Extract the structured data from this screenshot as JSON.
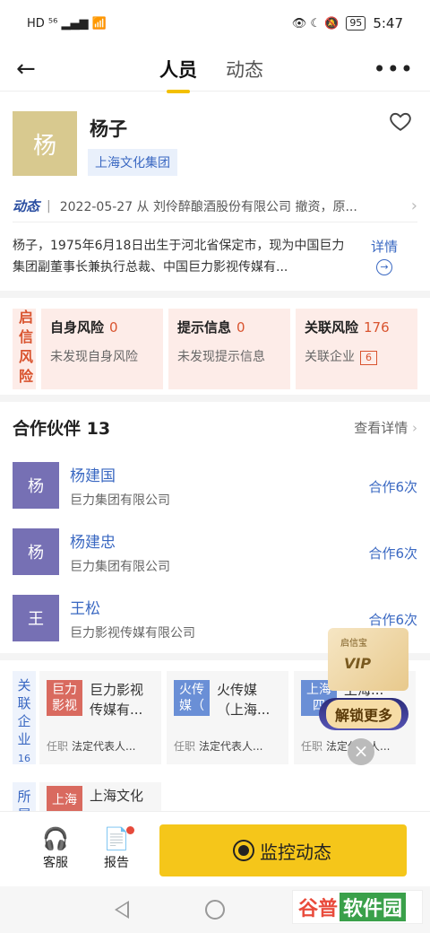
{
  "status_bar": {
    "left_icons": "HD ⁵⁶ ▂▄▆ 📶",
    "right_icons": "👁 ☾ 🔕",
    "battery": "95",
    "time": "5:47"
  },
  "header": {
    "tabs": [
      {
        "label": "人员",
        "active": true
      },
      {
        "label": "动态",
        "active": false
      }
    ],
    "more": "•••"
  },
  "profile": {
    "avatar_char": "杨",
    "name": "杨子",
    "company_tag": "上海文化集团",
    "dynamic_label": "动态",
    "dynamic_text": "2022-05-27 从 刘伶醉酿酒股份有限公司 撤资，原...",
    "bio": "杨子，1975年6月18日出生于河北省保定市，现为中国巨力集团副董事长兼执行总裁、中国巨力影视传媒有...",
    "detail_label": "详情"
  },
  "risk": {
    "side_label": "启信风险",
    "cards": [
      {
        "title": "自身风险",
        "count": "0",
        "sub": "未发现自身风险"
      },
      {
        "title": "提示信息",
        "count": "0",
        "sub": "未发现提示信息"
      },
      {
        "title": "关联风险",
        "count": "176",
        "sub": "关联企业",
        "badge": "6"
      }
    ]
  },
  "partners": {
    "title": "合作伙伴 13",
    "more": "查看详情",
    "items": [
      {
        "avatar": "杨",
        "name": "杨建国",
        "company": "巨力集团有限公司",
        "times": "合作6次"
      },
      {
        "avatar": "杨",
        "name": "杨建忠",
        "company": "巨力集团有限公司",
        "times": "合作6次"
      },
      {
        "avatar": "王",
        "name": "王松",
        "company": "巨力影视传媒有限公司",
        "times": "合作6次"
      }
    ]
  },
  "related": {
    "side_label": "关联企业",
    "side_count": "16",
    "cards": [
      {
        "logo": "巨力影视",
        "logo_color": "#d96a5f",
        "name": "巨力影视传媒有...",
        "role_label": "任职",
        "role": "法定代表人..."
      },
      {
        "logo": "火传媒（",
        "logo_color": "#6a8fd6",
        "name": "火传媒（上海...",
        "role_label": "任职",
        "role": "法定代表人..."
      },
      {
        "logo": "上海四",
        "logo_color": "#6a8fd6",
        "name": "上海...",
        "role_label": "任职",
        "role": "法定代表人..."
      }
    ],
    "own_side_label": "所属",
    "own_card": {
      "logo": "上海",
      "name": "上海文化"
    }
  },
  "vip": {
    "brand": "启信宝",
    "label": "VIP",
    "button": "解锁更多",
    "close": "×"
  },
  "actionbar": {
    "service": "客服",
    "report": "报告",
    "monitor": "监控动态"
  },
  "watermark": {
    "part_a": "谷普",
    "part_b": "软件园"
  },
  "colors": {
    "accent": "#f5c61a",
    "link": "#3a68c2",
    "risk": "#d9542f"
  }
}
